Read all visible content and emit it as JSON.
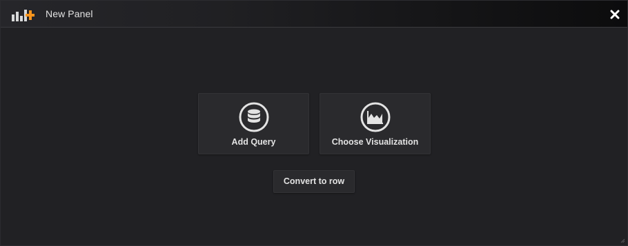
{
  "panel": {
    "title": "New Panel",
    "logo_icon": "add-panel-icon",
    "close_icon": "close-icon",
    "accent_color": "#f7941d"
  },
  "actions": [
    {
      "label": "Add Query",
      "icon": "database-icon"
    },
    {
      "label": "Choose Visualization",
      "icon": "area-chart-icon"
    }
  ],
  "convert": {
    "label": "Convert to row"
  }
}
